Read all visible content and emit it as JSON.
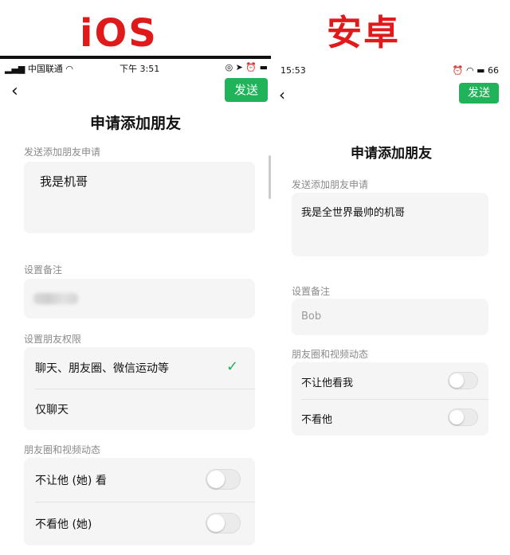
{
  "labels": {
    "ios": "iOS",
    "android": "安卓"
  },
  "ios": {
    "status": {
      "carrier": "中国联通",
      "time": "下午 3:51"
    },
    "back_icon": "chevron-left",
    "send_label": "发送",
    "title": "申请添加朋友",
    "request_section": "发送添加朋友申请",
    "request_text": "我是机哥",
    "remark_section": "设置备注",
    "permission_section": "设置朋友权限",
    "permission_options": [
      "聊天、朋友圈、微信运动等",
      "仅聊天"
    ],
    "moments_section": "朋友圈和视频动态",
    "moments_rows": [
      "不让他 (她) 看",
      "不看他 (她)"
    ]
  },
  "android": {
    "status": {
      "time": "15:53",
      "battery": "66"
    },
    "back_icon": "chevron-left",
    "send_label": "发送",
    "title": "申请添加朋友",
    "request_section": "发送添加朋友申请",
    "request_text": "我是全世界最帅的机哥",
    "remark_section": "设置备注",
    "remark_value": "Bob",
    "moments_section": "朋友圈和视频动态",
    "moments_rows": [
      "不让他看我",
      "不看他"
    ]
  },
  "colors": {
    "accent": "#21b35a",
    "label_red": "#e01a1a"
  }
}
